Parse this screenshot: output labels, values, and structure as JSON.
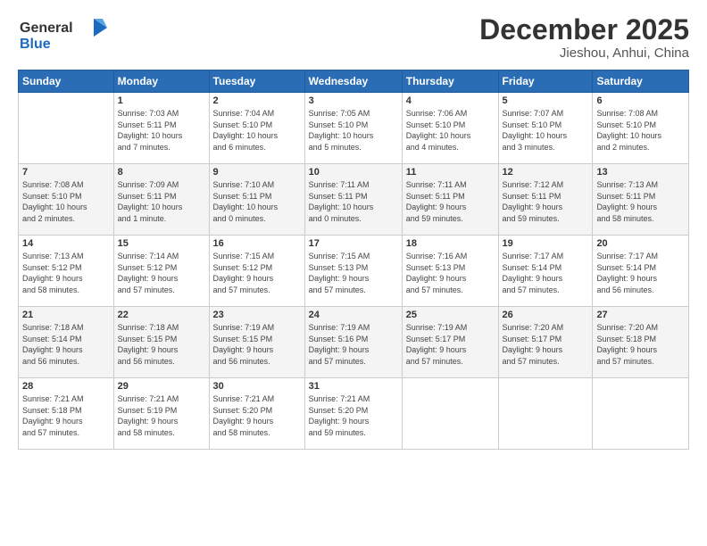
{
  "header": {
    "logo_line1": "General",
    "logo_line2": "Blue",
    "month": "December 2025",
    "location": "Jieshou, Anhui, China"
  },
  "weekdays": [
    "Sunday",
    "Monday",
    "Tuesday",
    "Wednesday",
    "Thursday",
    "Friday",
    "Saturday"
  ],
  "weeks": [
    [
      {
        "day": "",
        "info": ""
      },
      {
        "day": "1",
        "info": "Sunrise: 7:03 AM\nSunset: 5:11 PM\nDaylight: 10 hours\nand 7 minutes."
      },
      {
        "day": "2",
        "info": "Sunrise: 7:04 AM\nSunset: 5:10 PM\nDaylight: 10 hours\nand 6 minutes."
      },
      {
        "day": "3",
        "info": "Sunrise: 7:05 AM\nSunset: 5:10 PM\nDaylight: 10 hours\nand 5 minutes."
      },
      {
        "day": "4",
        "info": "Sunrise: 7:06 AM\nSunset: 5:10 PM\nDaylight: 10 hours\nand 4 minutes."
      },
      {
        "day": "5",
        "info": "Sunrise: 7:07 AM\nSunset: 5:10 PM\nDaylight: 10 hours\nand 3 minutes."
      },
      {
        "day": "6",
        "info": "Sunrise: 7:08 AM\nSunset: 5:10 PM\nDaylight: 10 hours\nand 2 minutes."
      }
    ],
    [
      {
        "day": "7",
        "info": "Sunrise: 7:08 AM\nSunset: 5:10 PM\nDaylight: 10 hours\nand 2 minutes."
      },
      {
        "day": "8",
        "info": "Sunrise: 7:09 AM\nSunset: 5:11 PM\nDaylight: 10 hours\nand 1 minute."
      },
      {
        "day": "9",
        "info": "Sunrise: 7:10 AM\nSunset: 5:11 PM\nDaylight: 10 hours\nand 0 minutes."
      },
      {
        "day": "10",
        "info": "Sunrise: 7:11 AM\nSunset: 5:11 PM\nDaylight: 10 hours\nand 0 minutes."
      },
      {
        "day": "11",
        "info": "Sunrise: 7:11 AM\nSunset: 5:11 PM\nDaylight: 9 hours\nand 59 minutes."
      },
      {
        "day": "12",
        "info": "Sunrise: 7:12 AM\nSunset: 5:11 PM\nDaylight: 9 hours\nand 59 minutes."
      },
      {
        "day": "13",
        "info": "Sunrise: 7:13 AM\nSunset: 5:11 PM\nDaylight: 9 hours\nand 58 minutes."
      }
    ],
    [
      {
        "day": "14",
        "info": "Sunrise: 7:13 AM\nSunset: 5:12 PM\nDaylight: 9 hours\nand 58 minutes."
      },
      {
        "day": "15",
        "info": "Sunrise: 7:14 AM\nSunset: 5:12 PM\nDaylight: 9 hours\nand 57 minutes."
      },
      {
        "day": "16",
        "info": "Sunrise: 7:15 AM\nSunset: 5:12 PM\nDaylight: 9 hours\nand 57 minutes."
      },
      {
        "day": "17",
        "info": "Sunrise: 7:15 AM\nSunset: 5:13 PM\nDaylight: 9 hours\nand 57 minutes."
      },
      {
        "day": "18",
        "info": "Sunrise: 7:16 AM\nSunset: 5:13 PM\nDaylight: 9 hours\nand 57 minutes."
      },
      {
        "day": "19",
        "info": "Sunrise: 7:17 AM\nSunset: 5:14 PM\nDaylight: 9 hours\nand 57 minutes."
      },
      {
        "day": "20",
        "info": "Sunrise: 7:17 AM\nSunset: 5:14 PM\nDaylight: 9 hours\nand 56 minutes."
      }
    ],
    [
      {
        "day": "21",
        "info": "Sunrise: 7:18 AM\nSunset: 5:14 PM\nDaylight: 9 hours\nand 56 minutes."
      },
      {
        "day": "22",
        "info": "Sunrise: 7:18 AM\nSunset: 5:15 PM\nDaylight: 9 hours\nand 56 minutes."
      },
      {
        "day": "23",
        "info": "Sunrise: 7:19 AM\nSunset: 5:15 PM\nDaylight: 9 hours\nand 56 minutes."
      },
      {
        "day": "24",
        "info": "Sunrise: 7:19 AM\nSunset: 5:16 PM\nDaylight: 9 hours\nand 57 minutes."
      },
      {
        "day": "25",
        "info": "Sunrise: 7:19 AM\nSunset: 5:17 PM\nDaylight: 9 hours\nand 57 minutes."
      },
      {
        "day": "26",
        "info": "Sunrise: 7:20 AM\nSunset: 5:17 PM\nDaylight: 9 hours\nand 57 minutes."
      },
      {
        "day": "27",
        "info": "Sunrise: 7:20 AM\nSunset: 5:18 PM\nDaylight: 9 hours\nand 57 minutes."
      }
    ],
    [
      {
        "day": "28",
        "info": "Sunrise: 7:21 AM\nSunset: 5:18 PM\nDaylight: 9 hours\nand 57 minutes."
      },
      {
        "day": "29",
        "info": "Sunrise: 7:21 AM\nSunset: 5:19 PM\nDaylight: 9 hours\nand 58 minutes."
      },
      {
        "day": "30",
        "info": "Sunrise: 7:21 AM\nSunset: 5:20 PM\nDaylight: 9 hours\nand 58 minutes."
      },
      {
        "day": "31",
        "info": "Sunrise: 7:21 AM\nSunset: 5:20 PM\nDaylight: 9 hours\nand 59 minutes."
      },
      {
        "day": "",
        "info": ""
      },
      {
        "day": "",
        "info": ""
      },
      {
        "day": "",
        "info": ""
      }
    ]
  ]
}
